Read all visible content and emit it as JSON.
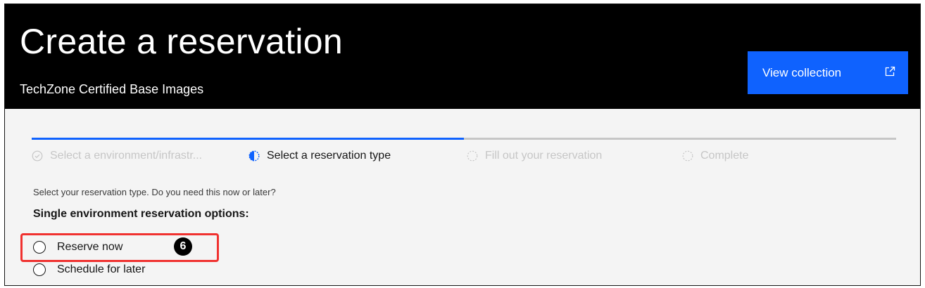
{
  "header": {
    "title": "Create a reservation",
    "subtitle": "TechZone Certified Base Images",
    "view_collection_label": "View collection"
  },
  "progress": {
    "fraction_complete": 0.5,
    "steps": [
      {
        "label": "Select a environment/infrastr...",
        "state": "complete"
      },
      {
        "label": "Select a reservation type",
        "state": "current"
      },
      {
        "label": "Fill out your reservation",
        "state": "incomplete"
      },
      {
        "label": "Complete",
        "state": "incomplete"
      }
    ]
  },
  "form": {
    "instruction": "Select your reservation type. Do you need this now or later?",
    "section_label": "Single environment reservation options:",
    "options": [
      {
        "label": "Reserve now",
        "selected": false
      },
      {
        "label": "Schedule for later",
        "selected": false
      }
    ],
    "callout_number": "6"
  },
  "colors": {
    "header_bg": "#000000",
    "primary": "#0f62fe",
    "highlight": "#f0312f",
    "muted": "#c6c6c6"
  }
}
